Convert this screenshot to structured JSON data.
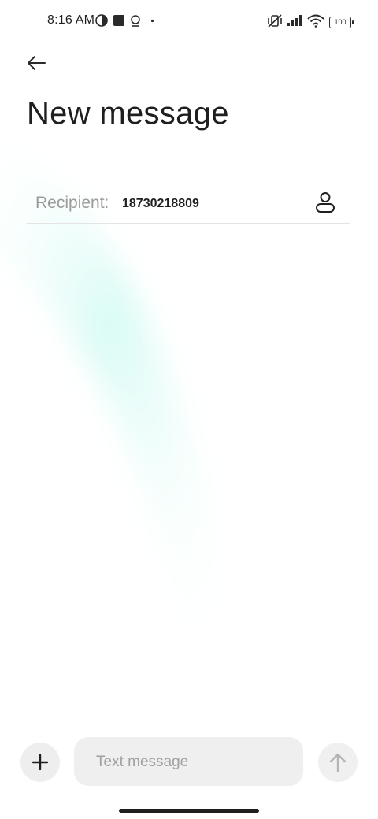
{
  "status_bar": {
    "time": "8:16 AM",
    "battery": "100",
    "left_icons": [
      "data-saver-icon",
      "square-notification-icon",
      "location-pin-icon",
      "dot-icon"
    ],
    "right_icons": [
      "vibrate-silent-icon",
      "signal-icon",
      "wifi-icon",
      "battery-icon"
    ]
  },
  "header": {
    "back_icon": "arrow-left-icon",
    "title": "New message"
  },
  "recipient": {
    "label": "Recipient:",
    "value": "18730218809",
    "contact_icon": "person-icon"
  },
  "compose": {
    "attach_icon": "plus-icon",
    "placeholder": "Text message",
    "value": "",
    "send_icon": "arrow-up-icon"
  },
  "colors": {
    "accent_gradient": "#d8fbf5",
    "text_primary": "#1f1f1f",
    "text_secondary": "#9a9a9a",
    "input_bg": "#efefef"
  }
}
